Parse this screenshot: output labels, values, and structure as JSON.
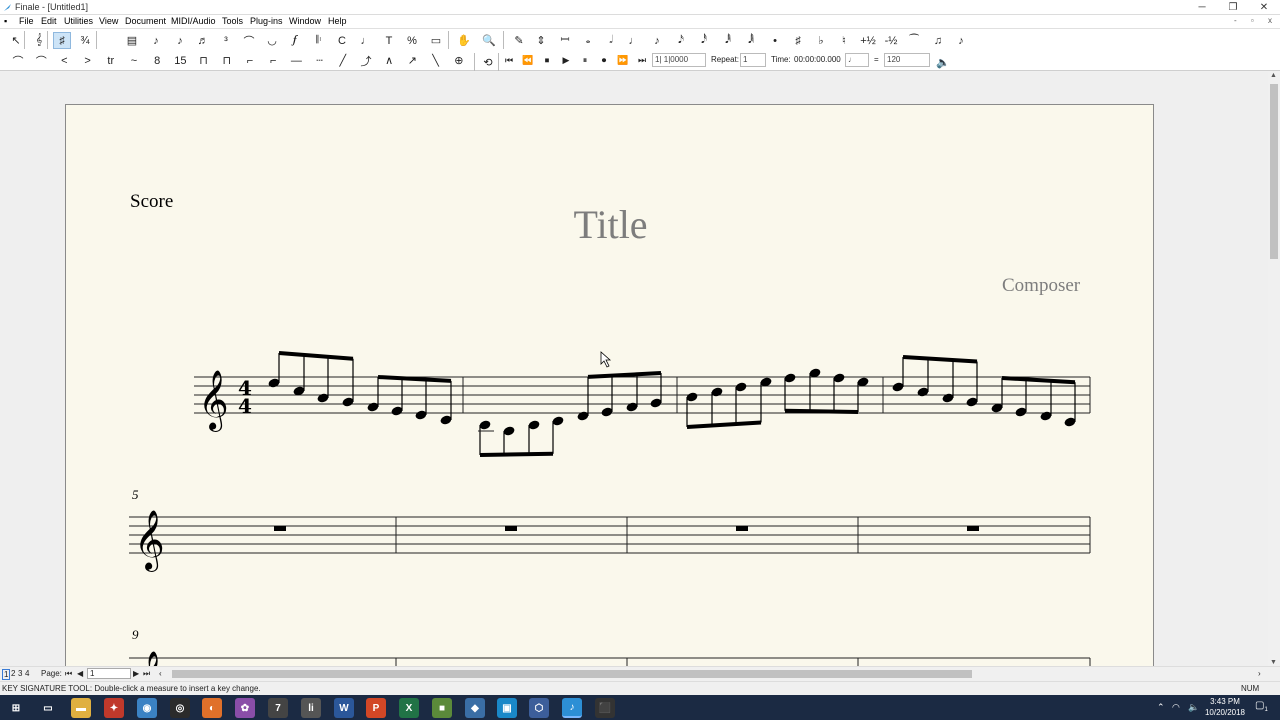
{
  "window": {
    "title": "Finale - [Untitled1]",
    "minimize": "─",
    "restore": "❐",
    "close": "✕",
    "doc_controls": "- ▫ x"
  },
  "menu": [
    "File",
    "Edit",
    "Utilities",
    "View",
    "Document",
    "MIDI/Audio",
    "Tools",
    "Plug-ins",
    "Window",
    "Help"
  ],
  "toolbar1": [
    {
      "icon": "selection-tool-icon",
      "glyph": "↖",
      "sel": false
    },
    {
      "icon": "staff-tool-icon",
      "glyph": "𝄞",
      "sel": false
    },
    {
      "icon": "key-signature-tool-icon",
      "glyph": "♯",
      "sel": true
    },
    {
      "icon": "time-signature-tool-icon",
      "glyph": "¾",
      "sel": false
    },
    {
      "icon": "measure-tool-icon",
      "glyph": "▤",
      "sel": false
    },
    {
      "icon": "simple-entry-icon",
      "glyph": "♪",
      "sel": false
    },
    {
      "icon": "speedy-entry-icon",
      "glyph": "♪",
      "sel": false
    },
    {
      "icon": "hyperscribe-icon",
      "glyph": "♬",
      "sel": false
    },
    {
      "icon": "tuplet-tool-icon",
      "glyph": "³",
      "sel": false
    },
    {
      "icon": "smart-shape-tool-icon",
      "glyph": "⌒",
      "sel": false
    },
    {
      "icon": "articulation-tool-icon",
      "glyph": "◡",
      "sel": false
    },
    {
      "icon": "expression-tool-icon",
      "glyph": "𝆑",
      "sel": false
    },
    {
      "icon": "repeat-tool-icon",
      "glyph": "𝄆",
      "sel": false
    },
    {
      "icon": "chord-tool-icon",
      "glyph": "C",
      "sel": false
    },
    {
      "icon": "lyrics-tool-icon",
      "glyph": "♩",
      "sel": false
    },
    {
      "icon": "text-tool-icon",
      "glyph": "T",
      "sel": false
    },
    {
      "icon": "resize-tool-icon",
      "glyph": "%",
      "sel": false
    },
    {
      "icon": "page-layout-tool-icon",
      "glyph": "▭",
      "sel": false
    },
    {
      "icon": "hand-grabber-icon",
      "glyph": "✋",
      "sel": false
    },
    {
      "icon": "zoom-tool-icon",
      "glyph": "🔍",
      "sel": false
    },
    {
      "icon": "eraser-icon",
      "glyph": "✎",
      "sel": false
    },
    {
      "icon": "half-step-icon",
      "glyph": "⇕",
      "sel": false
    },
    {
      "icon": "rest-palette-icon",
      "glyph": "𝄩",
      "sel": false
    },
    {
      "icon": "whole-note-icon",
      "glyph": "𝅝",
      "sel": false
    },
    {
      "icon": "half-note-icon",
      "glyph": "𝅗𝅥",
      "sel": false
    },
    {
      "icon": "quarter-note-icon",
      "glyph": "♩",
      "sel": false
    },
    {
      "icon": "eighth-note-icon",
      "glyph": "♪",
      "sel": false
    },
    {
      "icon": "sixteenth-note-icon",
      "glyph": "𝅘𝅥𝅯",
      "sel": false
    },
    {
      "icon": "thirtysecond-note-icon",
      "glyph": "𝅘𝅥𝅰",
      "sel": false
    },
    {
      "icon": "sixtyfourth-note-icon",
      "glyph": "𝅘𝅥𝅱",
      "sel": false
    },
    {
      "icon": "one-twenty-eighth-note-icon",
      "glyph": "𝅘𝅥𝅲",
      "sel": false
    },
    {
      "icon": "dot-icon",
      "glyph": "•",
      "sel": false
    },
    {
      "icon": "sharp-icon",
      "glyph": "♯",
      "sel": false
    },
    {
      "icon": "flat-icon",
      "glyph": "♭",
      "sel": false
    },
    {
      "icon": "natural-icon",
      "glyph": "♮",
      "sel": false
    },
    {
      "icon": "raise-step-icon",
      "glyph": "+½",
      "sel": false
    },
    {
      "icon": "lower-step-icon",
      "glyph": "-½",
      "sel": false
    },
    {
      "icon": "tie-icon",
      "glyph": "⁀",
      "sel": false
    },
    {
      "icon": "tuplet-entry-icon",
      "glyph": "♫",
      "sel": false
    },
    {
      "icon": "grace-note-icon",
      "glyph": "♪",
      "sel": false
    }
  ],
  "toolbar2": [
    {
      "icon": "slur-icon",
      "glyph": "⌒"
    },
    {
      "icon": "slur-dashed-icon",
      "glyph": "⌒"
    },
    {
      "icon": "crescendo-icon",
      "glyph": "<"
    },
    {
      "icon": "decrescendo-icon",
      "glyph": ">"
    },
    {
      "icon": "trill-icon",
      "glyph": "tr"
    },
    {
      "icon": "trill-extension-icon",
      "glyph": "~"
    },
    {
      "icon": "ottava-icon",
      "glyph": "8"
    },
    {
      "icon": "quindicesima-icon",
      "glyph": "15"
    },
    {
      "icon": "bracket-icon",
      "glyph": "⊓"
    },
    {
      "icon": "dashed-bracket-icon",
      "glyph": "⊓"
    },
    {
      "icon": "line-bracket-icon",
      "glyph": "⌐"
    },
    {
      "icon": "line-bracket2-icon",
      "glyph": "⌐"
    },
    {
      "icon": "line-icon",
      "glyph": "—"
    },
    {
      "icon": "dashed-line-icon",
      "glyph": "┄"
    },
    {
      "icon": "diagonal-line-icon",
      "glyph": "╱"
    },
    {
      "icon": "glissando-icon",
      "glyph": "⤴"
    },
    {
      "icon": "bend-hat-icon",
      "glyph": "∧"
    },
    {
      "icon": "guitar-bend-icon",
      "glyph": "↗"
    },
    {
      "icon": "custom-line-icon",
      "glyph": "╲"
    },
    {
      "icon": "target-icon",
      "glyph": "⊕"
    }
  ],
  "playback": {
    "loop_icon": "⟲",
    "buttons": [
      "⏮",
      "⏪",
      "⏹",
      "▶",
      "⏸",
      "⏺",
      "⏩",
      "⏭"
    ],
    "measure": "1| 1|0000",
    "repeat_label": "Repeat:",
    "repeat_value": "1",
    "time_label": "Time:",
    "time_value": "00:00:00.000",
    "tempo_eq": "=",
    "tempo_value": "120"
  },
  "score": {
    "part_label": "Score",
    "title": "Title",
    "composer": "Composer",
    "measure_5": "5",
    "measure_9": "9"
  },
  "bottom": {
    "pages": [
      "1",
      "2",
      "3",
      "4"
    ],
    "page_label": "Page:",
    "page_value": "1"
  },
  "status": {
    "text": "KEY SIGNATURE TOOL: Double-click a measure to insert a key change.",
    "num": "NUM"
  },
  "taskbar": {
    "apps": [
      {
        "icon": "windows-start-icon",
        "glyph": "⊞",
        "color": "transparent"
      },
      {
        "icon": "task-view-icon",
        "glyph": "▭",
        "color": "transparent"
      },
      {
        "icon": "file-explorer-icon",
        "glyph": "▬",
        "color": "#e0b040"
      },
      {
        "icon": "app-red-icon",
        "glyph": "✦",
        "color": "#c0392b"
      },
      {
        "icon": "chrome-icon",
        "glyph": "◉",
        "color": "#3b82c4"
      },
      {
        "icon": "steam-icon",
        "glyph": "◎",
        "color": "#2b2b2b"
      },
      {
        "icon": "firefox-icon",
        "glyph": "◐",
        "color": "#e0702a"
      },
      {
        "icon": "app-colorful-icon",
        "glyph": "✿",
        "color": "#8a4ea8"
      },
      {
        "icon": "app-seven-icon",
        "glyph": "7",
        "color": "#444"
      },
      {
        "icon": "app-lives-icon",
        "glyph": "li",
        "color": "#555"
      },
      {
        "icon": "word-icon",
        "glyph": "W",
        "color": "#2b579a"
      },
      {
        "icon": "powerpoint-icon",
        "glyph": "P",
        "color": "#d24726"
      },
      {
        "icon": "excel-icon",
        "glyph": "X",
        "color": "#217346"
      },
      {
        "icon": "minecraft-icon",
        "glyph": "■",
        "color": "#5b8a3a"
      },
      {
        "icon": "app-diamond-icon",
        "glyph": "◆",
        "color": "#3a6ea5"
      },
      {
        "icon": "app-blue-icon",
        "glyph": "▣",
        "color": "#1a88c8"
      },
      {
        "icon": "virtualbox-icon",
        "glyph": "⬡",
        "color": "#3c5e9a"
      },
      {
        "icon": "finale-icon",
        "glyph": "♪",
        "color": "#2d8fd5"
      },
      {
        "icon": "app-dark-icon",
        "glyph": "⬛",
        "color": "#333"
      }
    ],
    "time": "3:43 PM",
    "date": "10/20/2018",
    "notifications": "1"
  },
  "colors": {
    "page": "#faf8ec",
    "taskbar": "#1b2a43",
    "accent": "#cde4f7"
  }
}
